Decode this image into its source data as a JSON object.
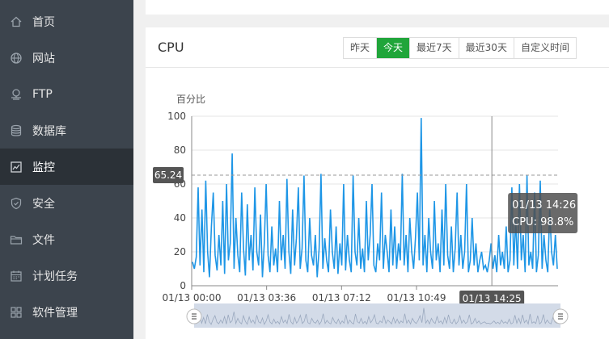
{
  "sidebar": {
    "items": [
      {
        "label": "首页",
        "icon": "home-icon"
      },
      {
        "label": "网站",
        "icon": "globe-icon"
      },
      {
        "label": "FTP",
        "icon": "ftp-icon"
      },
      {
        "label": "数据库",
        "icon": "database-icon"
      },
      {
        "label": "监控",
        "icon": "monitor-icon",
        "active": true
      },
      {
        "label": "安全",
        "icon": "shield-icon"
      },
      {
        "label": "文件",
        "icon": "folder-icon"
      },
      {
        "label": "计划任务",
        "icon": "calendar-icon"
      },
      {
        "label": "软件管理",
        "icon": "apps-icon"
      }
    ]
  },
  "cpu_panel": {
    "title": "CPU",
    "ranges": [
      {
        "label": "昨天"
      },
      {
        "label": "今天",
        "active": true
      },
      {
        "label": "最近7天"
      },
      {
        "label": "最近30天"
      },
      {
        "label": "自定义时间"
      }
    ]
  },
  "colors": {
    "accent": "#20a53a",
    "line": "#1e96e6",
    "sidebar": "#3c444d",
    "sidebar_active": "#2b3137"
  },
  "chart_data": {
    "type": "line",
    "ylabel": "百分比",
    "ylim": [
      0,
      100
    ],
    "yticks": [
      "0",
      "20",
      "40",
      "60",
      "80",
      "100"
    ],
    "xticks": [
      "01/13 00:00",
      "01/13 03:36",
      "01/13 07:12",
      "01/13 10:49"
    ],
    "x_range_hours": [
      0,
      17.6
    ],
    "crosshair_label": "65.24",
    "crosshair_value": 65.24,
    "hover_time_label": "01/13 14:25",
    "hover_hours": 14.42,
    "tooltip": {
      "time": "01/13 14:26",
      "value": "CPU: 98.8%"
    },
    "series": [
      {
        "values": [
          14,
          10,
          17,
          58,
          12,
          45,
          8,
          62,
          20,
          5,
          35,
          55,
          18,
          9,
          30,
          12,
          50,
          7,
          60,
          15,
          25,
          78,
          10,
          40,
          18,
          8,
          55,
          22,
          6,
          48,
          15,
          30,
          9,
          58,
          20,
          12,
          42,
          5,
          25,
          60,
          18,
          8,
          35,
          12,
          22,
          8,
          50,
          15,
          30,
          10,
          63,
          20,
          7,
          45,
          12,
          28,
          58,
          10,
          22,
          65,
          15,
          8,
          40,
          18,
          12,
          30,
          5,
          22,
          66,
          10,
          28,
          15,
          8,
          45,
          20,
          10,
          35,
          7,
          25,
          12,
          60,
          9,
          30,
          15,
          8,
          65,
          20,
          12,
          40,
          10,
          22,
          8,
          50,
          15,
          30,
          60,
          12,
          8,
          25,
          15,
          55,
          10,
          30,
          20,
          8,
          45,
          12,
          35,
          10,
          25,
          15,
          66,
          12,
          30,
          8,
          40,
          20,
          10,
          28,
          55,
          15,
          99,
          12,
          30,
          8,
          40,
          20,
          10,
          50,
          15,
          25,
          8,
          45,
          12,
          60,
          18,
          10,
          35,
          8,
          22,
          55,
          12,
          30,
          10,
          20,
          60,
          8,
          15,
          40,
          12,
          25,
          8,
          15,
          20,
          10,
          12,
          8,
          15,
          25,
          10,
          18,
          8,
          30,
          12,
          20,
          10,
          35,
          8,
          15,
          58,
          12,
          40,
          10,
          60,
          15,
          30,
          8,
          65,
          12,
          20,
          10,
          55,
          8,
          18,
          62,
          10,
          30,
          15,
          8,
          45,
          20,
          12,
          30,
          10
        ]
      }
    ]
  }
}
